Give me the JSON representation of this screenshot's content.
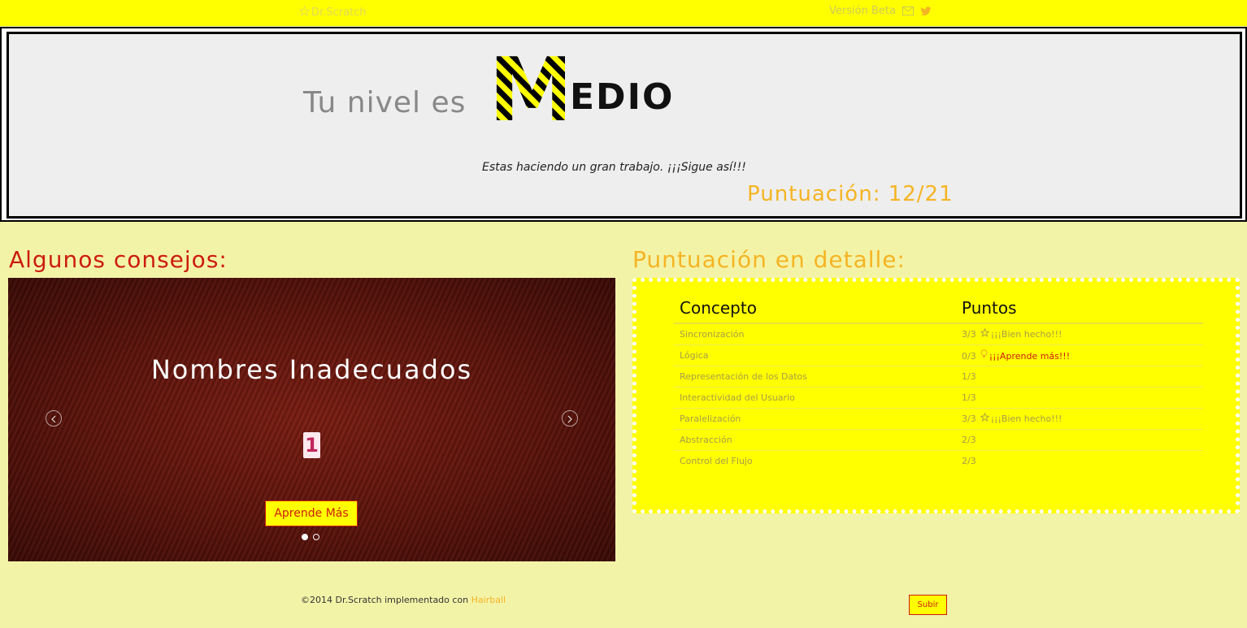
{
  "navbar": {
    "brand": "Dr.Scratch",
    "brand_icon": "star-outline-icon",
    "version": "Versión Beta",
    "icons": [
      "mail-icon",
      "twitter-icon"
    ]
  },
  "hero": {
    "prefix": "Tu nivel es",
    "level_initial": "M",
    "level_rest": "EDIO",
    "message": "Estas haciendo un gran trabajo. ¡¡¡Sigue así!!!",
    "score": "Puntuación: 12/21"
  },
  "tips": {
    "title": "Algunos consejos:",
    "slide_title": "Nombres Inadecuados",
    "slide_number": "1",
    "button": "Aprende Más",
    "slide_count": 2,
    "active_slide": 1
  },
  "details": {
    "title": "Puntuación en detalle:",
    "headers": [
      "Concepto",
      "Puntos"
    ],
    "rows": [
      {
        "concept": "Sincronización",
        "points": "3/3",
        "note": "¡¡¡Bien hecho!!!",
        "note_icon": "star-outline-icon"
      },
      {
        "concept": "Lógica",
        "points": "0/3",
        "note": "¡¡¡Aprende más!!!",
        "note_icon": "lightbulb-icon"
      },
      {
        "concept": "Representación de los Datos",
        "points": "1/3",
        "note": "",
        "note_icon": ""
      },
      {
        "concept": "Interactividad del Usuario",
        "points": "1/3",
        "note": "",
        "note_icon": ""
      },
      {
        "concept": "Paralelización",
        "points": "3/3",
        "note": "¡¡¡Bien hecho!!!",
        "note_icon": "star-outline-icon"
      },
      {
        "concept": "Abstracción",
        "points": "2/3",
        "note": "",
        "note_icon": ""
      },
      {
        "concept": "Control del Flujo",
        "points": "2/3",
        "note": "",
        "note_icon": ""
      }
    ]
  },
  "footer": {
    "text": "©2014 Dr.Scratch implementado con",
    "link": "Hairball",
    "up_button": "Subir"
  },
  "colors": {
    "brand_yellow": "#ffff00",
    "page_bg": "#f3f3a8",
    "accent_red": "#cc1c10",
    "accent_orange": "#f5b423"
  }
}
